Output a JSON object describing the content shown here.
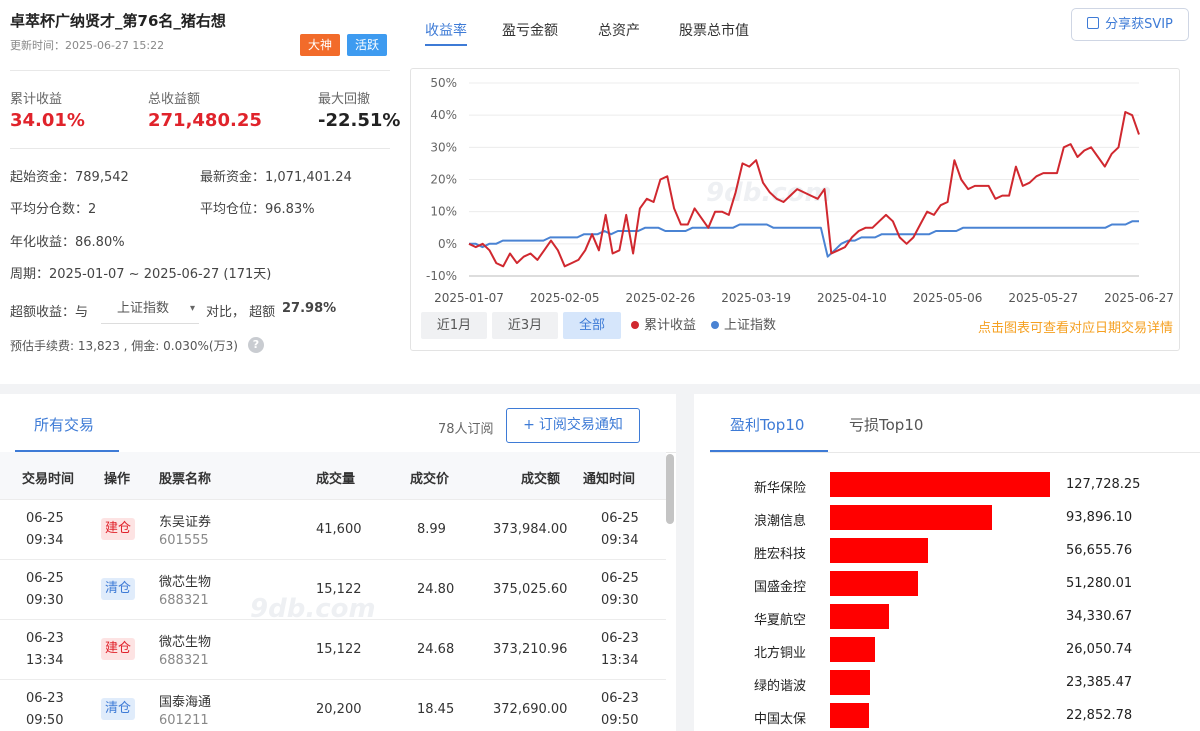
{
  "header": {
    "title": "卓萃杯广纳贤才_第76名_猪右想",
    "update_time": "更新时间：2025-06-27 15:22",
    "badges": [
      "大神",
      "活跃"
    ]
  },
  "stats": {
    "cum_return_label": "累计收益",
    "cum_return": "34.01%",
    "total_profit_label": "总收益额",
    "total_profit": "271,480.25",
    "max_drawdown_label": "最大回撤",
    "max_drawdown": "-22.51%"
  },
  "info": {
    "start_capital": "起始资金：789,542",
    "latest_capital": "最新资金：1,071,401.24",
    "avg_positions": "平均分仓数：2",
    "avg_position_ratio": "平均仓位：96.83%",
    "annual_return": "年化收益：86.80%",
    "period": "周期：2025-01-07 ~ 2025-06-27 (171天)",
    "excess_prefix": "超额收益：与",
    "benchmark_select": "上证指数",
    "excess_mid": "对比，  超额",
    "excess_value": "27.98%",
    "fees": "预估手续费: 13,823 , 佣金: 0.030%(万3)"
  },
  "top_tabs": [
    "收益率",
    "盈亏金额",
    "总资产",
    "股票总市值"
  ],
  "share_button": "分享获SVIP",
  "range_buttons": [
    "近1月",
    "近3月",
    "全部"
  ],
  "legend": [
    "累计收益",
    "上证指数"
  ],
  "chart_hint": "点击图表可查看对应日期交易详情",
  "watermark": "9db.com",
  "colors": {
    "accent": "#3e7bd6",
    "red": "#e0232b",
    "orange": "#f5a021"
  },
  "chart_data": {
    "type": "line",
    "x_ticks": [
      "2025-01-07",
      "2025-02-05",
      "2025-02-26",
      "2025-03-19",
      "2025-04-10",
      "2025-05-06",
      "2025-05-27",
      "2025-06-27"
    ],
    "y_ticks": [
      "50%",
      "40%",
      "30%",
      "20%",
      "10%",
      "0%",
      "-10%"
    ],
    "ylim": [
      -10,
      50
    ],
    "series": [
      {
        "name": "累计收益",
        "color": "#d0282f",
        "values": [
          0,
          -1,
          0,
          -2,
          -6,
          -7,
          -3,
          -6,
          -4,
          -3,
          -5,
          -2,
          1,
          -2,
          -7,
          -6,
          -5,
          -2,
          3,
          -2,
          9,
          -3,
          -2,
          9,
          -3,
          11,
          14,
          13,
          20,
          21,
          11,
          6,
          6,
          11,
          8,
          5,
          10,
          10,
          9,
          16,
          25,
          24,
          26,
          19,
          16,
          14,
          13,
          15,
          17,
          16,
          15,
          14,
          17,
          -3,
          -2,
          -1,
          2,
          4,
          5,
          5,
          7,
          9,
          7,
          2,
          0,
          2,
          6,
          10,
          9,
          12,
          13,
          26,
          20,
          17,
          18,
          18,
          18,
          14,
          15,
          15,
          24,
          18,
          19,
          21,
          22,
          22,
          22,
          30,
          31,
          27,
          29,
          30,
          27,
          24,
          28,
          30,
          41,
          40,
          34
        ]
      },
      {
        "name": "上证指数",
        "color": "#4a83d3",
        "values": [
          0,
          0,
          -1,
          0,
          0,
          1,
          1,
          1,
          1,
          1,
          1,
          1,
          2,
          2,
          2,
          2,
          2,
          3,
          3,
          3,
          4,
          3,
          4,
          4,
          4,
          4,
          5,
          5,
          5,
          4,
          4,
          4,
          4,
          5,
          5,
          5,
          5,
          5,
          5,
          5,
          6,
          6,
          6,
          6,
          6,
          5,
          5,
          5,
          5,
          5,
          5,
          5,
          5,
          -4,
          -2,
          0,
          1,
          1,
          2,
          2,
          2,
          3,
          3,
          3,
          3,
          3,
          3,
          3,
          3,
          4,
          4,
          4,
          4,
          5,
          5,
          5,
          5,
          5,
          5,
          5,
          5,
          5,
          5,
          5,
          5,
          5,
          5,
          5,
          5,
          5,
          5,
          5,
          5,
          5,
          5,
          6,
          6,
          6,
          7,
          7
        ]
      }
    ]
  },
  "trades": {
    "tab": "所有交易",
    "subscribers": "78人订阅",
    "subscribe_button": "订阅交易通知",
    "columns": [
      "交易时间",
      "操作",
      "股票名称",
      "成交量",
      "成交价",
      "成交额",
      "通知时间"
    ],
    "rows": [
      {
        "date": "06-25",
        "time": "09:34",
        "op": "建仓",
        "name": "东吴证券",
        "code": "601555",
        "vol": "41,600",
        "price": "8.99",
        "amount": "373,984.00",
        "ndate": "06-25",
        "ntime": "09:34"
      },
      {
        "date": "06-25",
        "time": "09:30",
        "op": "清仓",
        "name": "微芯生物",
        "code": "688321",
        "vol": "15,122",
        "price": "24.80",
        "amount": "375,025.60",
        "ndate": "06-25",
        "ntime": "09:30"
      },
      {
        "date": "06-23",
        "time": "13:34",
        "op": "建仓",
        "name": "微芯生物",
        "code": "688321",
        "vol": "15,122",
        "price": "24.68",
        "amount": "373,210.96",
        "ndate": "06-23",
        "ntime": "13:34"
      },
      {
        "date": "06-23",
        "time": "09:50",
        "op": "清仓",
        "name": "国泰海通",
        "code": "601211",
        "vol": "20,200",
        "price": "18.45",
        "amount": "372,690.00",
        "ndate": "06-23",
        "ntime": "09:50"
      }
    ]
  },
  "top10": {
    "tabs": [
      "盈利Top10",
      "亏损Top10"
    ],
    "items": [
      {
        "name": "新华保险",
        "value": 127728.25,
        "label": "127,728.25"
      },
      {
        "name": "浪潮信息",
        "value": 93896.1,
        "label": "93,896.10"
      },
      {
        "name": "胜宏科技",
        "value": 56655.76,
        "label": "56,655.76"
      },
      {
        "name": "国盛金控",
        "value": 51280.01,
        "label": "51,280.01"
      },
      {
        "name": "华夏航空",
        "value": 34330.67,
        "label": "34,330.67"
      },
      {
        "name": "北方铜业",
        "value": 26050.74,
        "label": "26,050.74"
      },
      {
        "name": "绿的谐波",
        "value": 23385.47,
        "label": "23,385.47"
      },
      {
        "name": "中国太保",
        "value": 22852.78,
        "label": "22,852.78"
      }
    ]
  }
}
